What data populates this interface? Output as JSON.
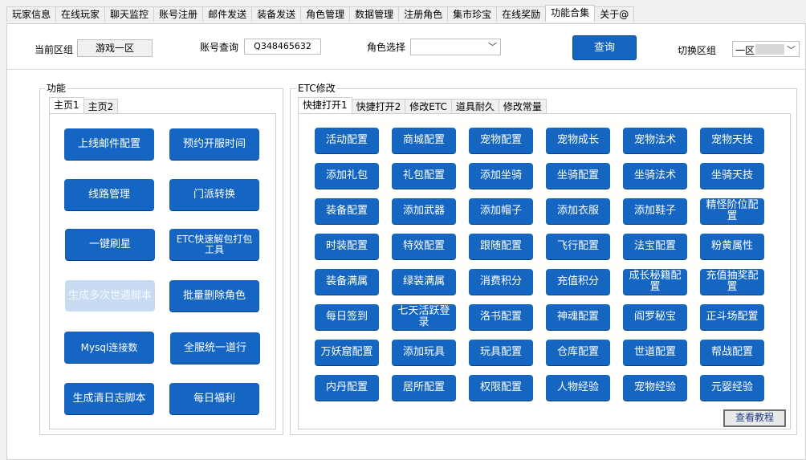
{
  "top_tabs": [
    "玩家信息",
    "在线玩家",
    "聊天监控",
    "账号注册",
    "邮件发送",
    "装备发送",
    "角色管理",
    "数据管理",
    "注册角色",
    "集市珍宝",
    "在线奖励",
    "功能合集",
    "关于@"
  ],
  "top_tabs_active": "功能合集",
  "toolbar": {
    "current_zone_label": "当前区组",
    "current_zone_value": "游戏一区",
    "account_query_label": "账号查询",
    "account_query_value": "Q348465632",
    "role_select_label": "角色选择",
    "role_select_value": "",
    "query_button": "查询",
    "switch_zone_label": "切换区组",
    "switch_zone_value": "一区"
  },
  "left_group": {
    "title": "功能",
    "tabs": [
      "主页1",
      "主页2"
    ],
    "active_tab": "主页1",
    "buttons": [
      "上线邮件配置",
      "预约开服时间",
      "线路管理",
      "门派转换",
      "一键刷星",
      "ETC快速解包打包工具",
      "生成多次世遁脚本",
      "批量删除角色",
      "Mysql连接数",
      "全服统一道行",
      "生成清日志脚本",
      "每日福利"
    ]
  },
  "right_group": {
    "title": "ETC修改",
    "tabs": [
      "快捷打开1",
      "快捷打开2",
      "修改ETC",
      "道具耐久",
      "修改常量"
    ],
    "active_tab": "快捷打开1",
    "buttons": [
      "活动配置",
      "商城配置",
      "宠物配置",
      "宠物成长",
      "宠物法术",
      "宠物天技",
      "添加礼包",
      "礼包配置",
      "添加坐骑",
      "坐骑配置",
      "坐骑法术",
      "坐骑天技",
      "装备配置",
      "添加武器",
      "添加帽子",
      "添加衣服",
      "添加鞋子",
      "精怪阶位配置",
      "时装配置",
      "特效配置",
      "跟随配置",
      "飞行配置",
      "法宝配置",
      "粉黄属性",
      "装备满属",
      "绿装满属",
      "消费积分",
      "充值积分",
      "成长秘籍配置",
      "充值抽奖配置",
      "每日签到",
      "七天活跃登录",
      "洛书配置",
      "神魂配置",
      "阎罗秘宝",
      "正斗场配置",
      "万妖窟配置",
      "添加玩具",
      "玩具配置",
      "仓库配置",
      "世道配置",
      "帮战配置",
      "内丹配置",
      "居所配置",
      "权限配置",
      "人物经验",
      "宠物经验",
      "元婴经验"
    ],
    "tutorial_button": "查看教程"
  },
  "colors": {
    "button_blue": "#1566c2",
    "button_disabled": "#c7dcf2"
  },
  "icons": {
    "combo_arrow": "chevron-down-icon"
  }
}
